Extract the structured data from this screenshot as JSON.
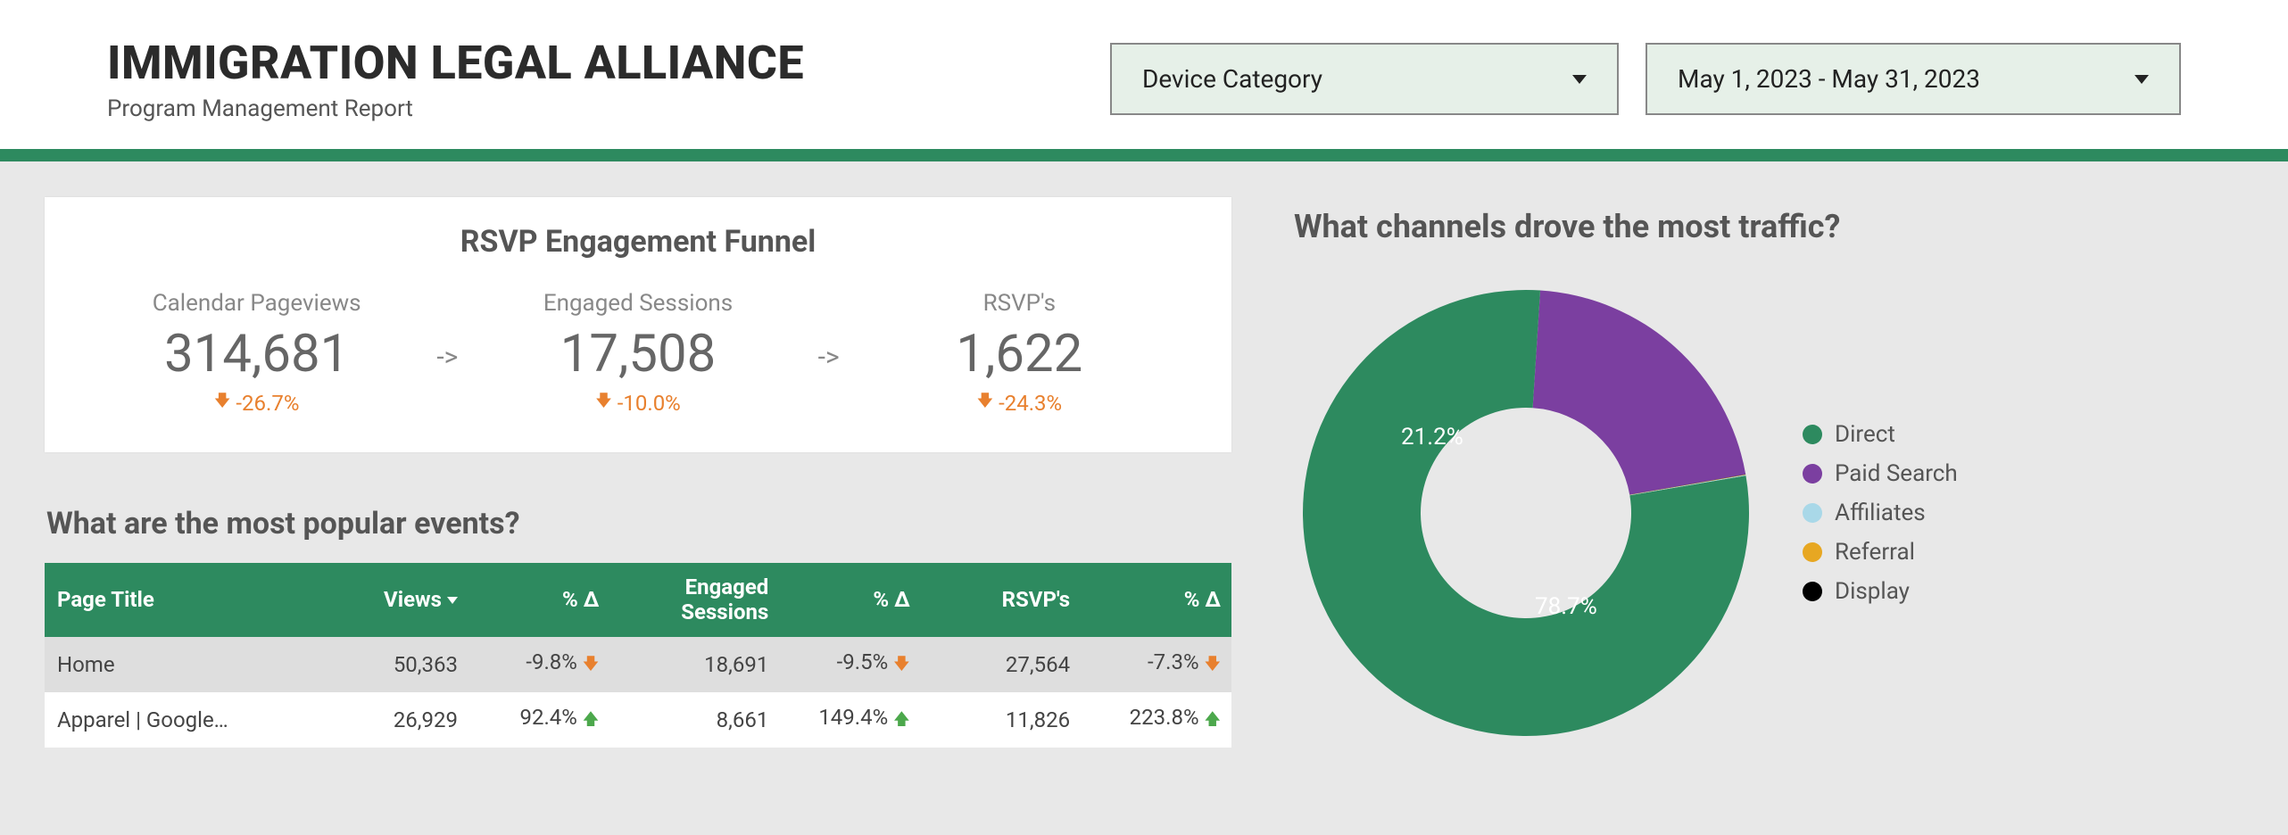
{
  "header": {
    "title": "IMMIGRATION LEGAL ALLIANCE",
    "subtitle": "Program Management Report",
    "device_dropdown": "Device Category",
    "date_range": "May 1, 2023 - May 31, 2023"
  },
  "funnel": {
    "title": "RSVP Engagement Funnel",
    "steps": [
      {
        "label": "Calendar Pageviews",
        "value": "314,681",
        "delta": "-26.7%",
        "dir": "down"
      },
      {
        "label": "Engaged Sessions",
        "value": "17,508",
        "delta": "-10.0%",
        "dir": "down"
      },
      {
        "label": "RSVP's",
        "value": "1,622",
        "delta": "-24.3%",
        "dir": "down"
      }
    ],
    "arrow": "->"
  },
  "events": {
    "heading": "What are the most popular events?",
    "columns": [
      "Page Title",
      "Views",
      "% Δ",
      "Engaged Sessions",
      "% Δ",
      "RSVP's",
      "% Δ"
    ],
    "engaged_sessions_header_l1": "Engaged",
    "engaged_sessions_header_l2": "Sessions",
    "rows": [
      {
        "title": "Home",
        "views": "50,363",
        "views_delta": "-9.8%",
        "views_dir": "down",
        "eng": "18,691",
        "eng_delta": "-9.5%",
        "eng_dir": "down",
        "rsvp": "27,564",
        "rsvp_delta": "-7.3%",
        "rsvp_dir": "down"
      },
      {
        "title": "Apparel | Google…",
        "views": "26,929",
        "views_delta": "92.4%",
        "views_dir": "up",
        "eng": "8,661",
        "eng_delta": "149.4%",
        "eng_dir": "up",
        "rsvp": "11,826",
        "rsvp_delta": "223.8%",
        "rsvp_dir": "up"
      }
    ]
  },
  "channels": {
    "heading": "What channels drove the most traffic?",
    "legend": [
      {
        "name": "Direct",
        "color": "#2d8a5f"
      },
      {
        "name": "Paid Search",
        "color": "#7b3fa0"
      },
      {
        "name": "Affiliates",
        "color": "#a9d8e8"
      },
      {
        "name": "Referral",
        "color": "#e7a722"
      },
      {
        "name": "Display",
        "color": "#000000"
      }
    ],
    "labels": {
      "direct": "78.7%",
      "paid": "21.2%"
    }
  },
  "chart_data": {
    "type": "pie",
    "title": "What channels drove the most traffic?",
    "series": [
      {
        "name": "Direct",
        "value": 78.7,
        "color": "#2d8a5f"
      },
      {
        "name": "Paid Search",
        "value": 21.2,
        "color": "#7b3fa0"
      },
      {
        "name": "Affiliates",
        "value": 0.05,
        "color": "#a9d8e8"
      },
      {
        "name": "Referral",
        "value": 0.03,
        "color": "#e7a722"
      },
      {
        "name": "Display",
        "value": 0.02,
        "color": "#000000"
      }
    ],
    "donut": true,
    "inner_radius_pct": 45
  }
}
